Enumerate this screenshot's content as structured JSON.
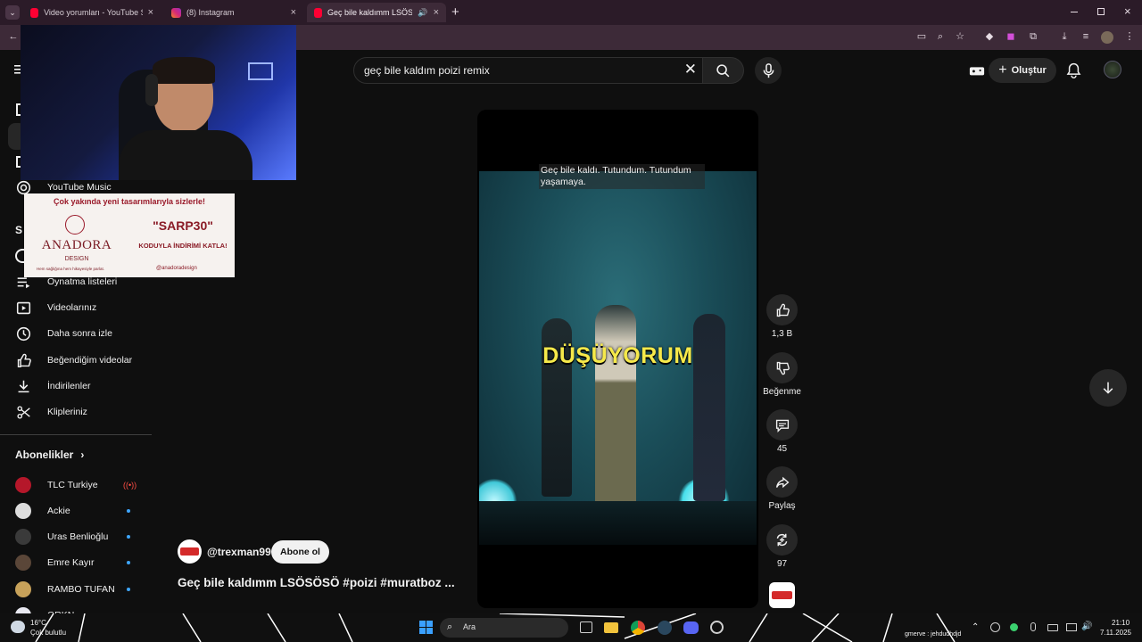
{
  "browser": {
    "tabs": [
      {
        "title": "Video yorumları - YouTube Studio",
        "favicon_color": "#ff0033"
      },
      {
        "title": "(8) Instagram",
        "favicon_color": "#d62976"
      },
      {
        "title": "Geç bile kaldımm LSÖSÖSÖ",
        "favicon_color": "#ff0033"
      }
    ],
    "new_tab": "+"
  },
  "search": {
    "query": "geç bile kaldım poizi remix"
  },
  "header": {
    "create_label": "Oluştur"
  },
  "sidebar": {
    "items": [
      {
        "label": "YouTube Music",
        "icon": "youtube-music-icon"
      },
      {
        "label": "Oynatma listeleri",
        "icon": "playlist-icon"
      },
      {
        "label": "Videolarınız",
        "icon": "your-videos-icon"
      },
      {
        "label": "Daha sonra izle",
        "icon": "watch-later-icon"
      },
      {
        "label": "Beğendiğim videolar",
        "icon": "liked-videos-icon"
      },
      {
        "label": "İndirilenler",
        "icon": "download-icon"
      },
      {
        "label": "Klipleriniz",
        "icon": "clips-icon"
      }
    ],
    "subscriptions_title": "Abonelikler",
    "subscriptions": [
      {
        "name": "TLC Turkiye",
        "color": "#b5172a",
        "live": true
      },
      {
        "name": "Ackie",
        "color": "#dddddd",
        "live": false
      },
      {
        "name": "Uras Benlioğlu",
        "color": "#3a3a3a",
        "live": false
      },
      {
        "name": "Emre Kayır",
        "color": "#5a4638",
        "live": false
      },
      {
        "name": "RAMBO TUFAN",
        "color": "#c8a25a",
        "live": false
      },
      {
        "name": "GRKN",
        "color": "#e8e8f0",
        "live": false
      }
    ]
  },
  "ad": {
    "headline": "Çok yakında yeni tasarımlarıyla sizlerle!",
    "code": "\"SARP30\"",
    "code_sub": "KODUYLA İNDİRİMİ KATLA!",
    "brand": "ANADORA",
    "brand_sub": "DESIGN",
    "tagline": "Hem sağlığına hem hikayesiyle parlat.",
    "handle": "@anadoradesign"
  },
  "short": {
    "caption": "Geç bile kaldı. Tutundum. Tutundum yaşamaya.",
    "overlay_text": "DÜŞÜYORUM",
    "channel": "@trexman99",
    "channel_avatar_text": "TREXMAN",
    "subscribe_label": "Abone ol",
    "title": "Geç bile kaldımm LSÖSÖSÖ #poizi #muratboz ..."
  },
  "actions": {
    "like_count": "1,3 B",
    "dislike_label": "Beğenme",
    "comment_count": "45",
    "share_label": "Paylaş",
    "remix_count": "97"
  },
  "taskbar": {
    "weather_temp": "16°C",
    "weather_desc": "Çok bulutlu",
    "search_placeholder": "Ara",
    "user_status": "gmerve : jehdudhdjd",
    "time": "21:10",
    "date": "7.11.2025"
  }
}
